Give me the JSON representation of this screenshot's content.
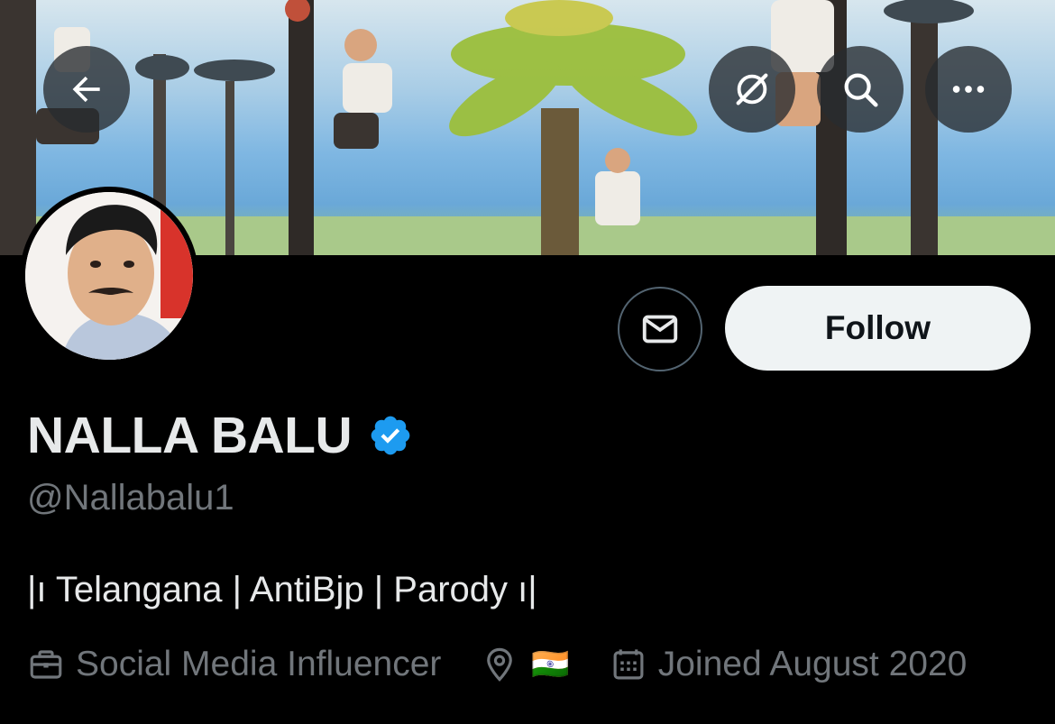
{
  "header": {
    "back_icon": "arrow-left-icon",
    "grok_icon": "grok-icon",
    "search_icon": "search-icon",
    "more_icon": "more-horizontal-icon"
  },
  "profile": {
    "name": "NALLA BALU",
    "verified": true,
    "handle": "@Nallabalu1",
    "bio": "|ı Telangana | AntiBjp | Parody ı|",
    "profession": "Social Media Influencer",
    "location_flag": "🇮🇳",
    "joined": "Joined August 2020"
  },
  "actions": {
    "follow_label": "Follow",
    "message_icon": "envelope-icon"
  },
  "colors": {
    "background": "#000000",
    "verified_blue": "#1d9bf0",
    "muted_text": "#71767b",
    "follow_bg": "#eff3f4"
  }
}
